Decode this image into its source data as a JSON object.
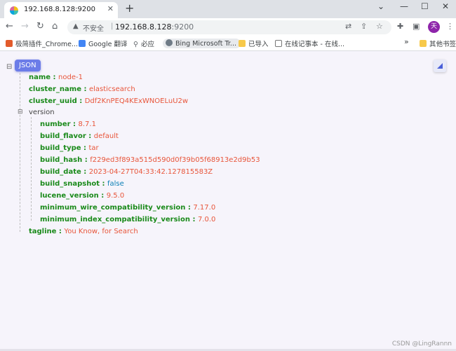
{
  "browser": {
    "tab_title": "192.168.8.128:9200",
    "tab_close": "✕",
    "new_tab": "+",
    "window_controls": {
      "minimize": "—",
      "restore": "☐",
      "close": "✕",
      "menu": "⌄"
    },
    "url_insecure_label": "不安全",
    "url_separator": "|",
    "url_host": "192.168.8.128",
    "url_port": ":9200",
    "avatar_initial": "天",
    "bookmarks": [
      {
        "label": "极简插件_Chrome...",
        "icon": "extension-icon"
      },
      {
        "label": "Google 翻译",
        "icon": "translate-icon"
      },
      {
        "label": "必应",
        "icon": "search-icon"
      },
      {
        "label": "Bing Microsoft Tr...",
        "icon": "bing-icon"
      },
      {
        "label": "已导入",
        "icon": "folder-icon"
      },
      {
        "label": "在线记事本 - 在线...",
        "icon": "notepad-icon"
      }
    ],
    "bookmarks_overflow": "»",
    "other_bookmarks": "其他书签"
  },
  "json_viewer": {
    "badge": "JSON",
    "root_toggle": "⊟",
    "colon": " : ",
    "fields": [
      {
        "key": "name",
        "value": "node-1",
        "type": "string"
      },
      {
        "key": "cluster_name",
        "value": "elasticsearch",
        "type": "string"
      },
      {
        "key": "cluster_uuid",
        "value": "Ddf2KnPEQ4KExWNOELuU2w",
        "type": "string"
      }
    ],
    "version_key": "version",
    "version_toggle": "⊟",
    "version_fields": [
      {
        "key": "number",
        "value": "8.7.1",
        "type": "string"
      },
      {
        "key": "build_flavor",
        "value": "default",
        "type": "string"
      },
      {
        "key": "build_type",
        "value": "tar",
        "type": "string"
      },
      {
        "key": "build_hash",
        "value": "f229ed3f893a515d590d0f39b05f68913e2d9b53",
        "type": "string"
      },
      {
        "key": "build_date",
        "value": "2023-04-27T04:33:42.127815583Z",
        "type": "string"
      },
      {
        "key": "build_snapshot",
        "value": "false",
        "type": "boolean"
      },
      {
        "key": "lucene_version",
        "value": "9.5.0",
        "type": "string"
      },
      {
        "key": "minimum_wire_compatibility_version",
        "value": "7.17.0",
        "type": "string"
      },
      {
        "key": "minimum_index_compatibility_version",
        "value": "7.0.0",
        "type": "string"
      }
    ],
    "tagline": {
      "key": "tagline",
      "value": "You Know, for Search",
      "type": "string"
    }
  },
  "watermark": "CSDN @LingRannn",
  "colors": {
    "key_green": "#1a8a1a",
    "string_red": "#e8553a",
    "boolean_blue": "#0b7fb5",
    "badge_blue": "#6b7ce8"
  }
}
